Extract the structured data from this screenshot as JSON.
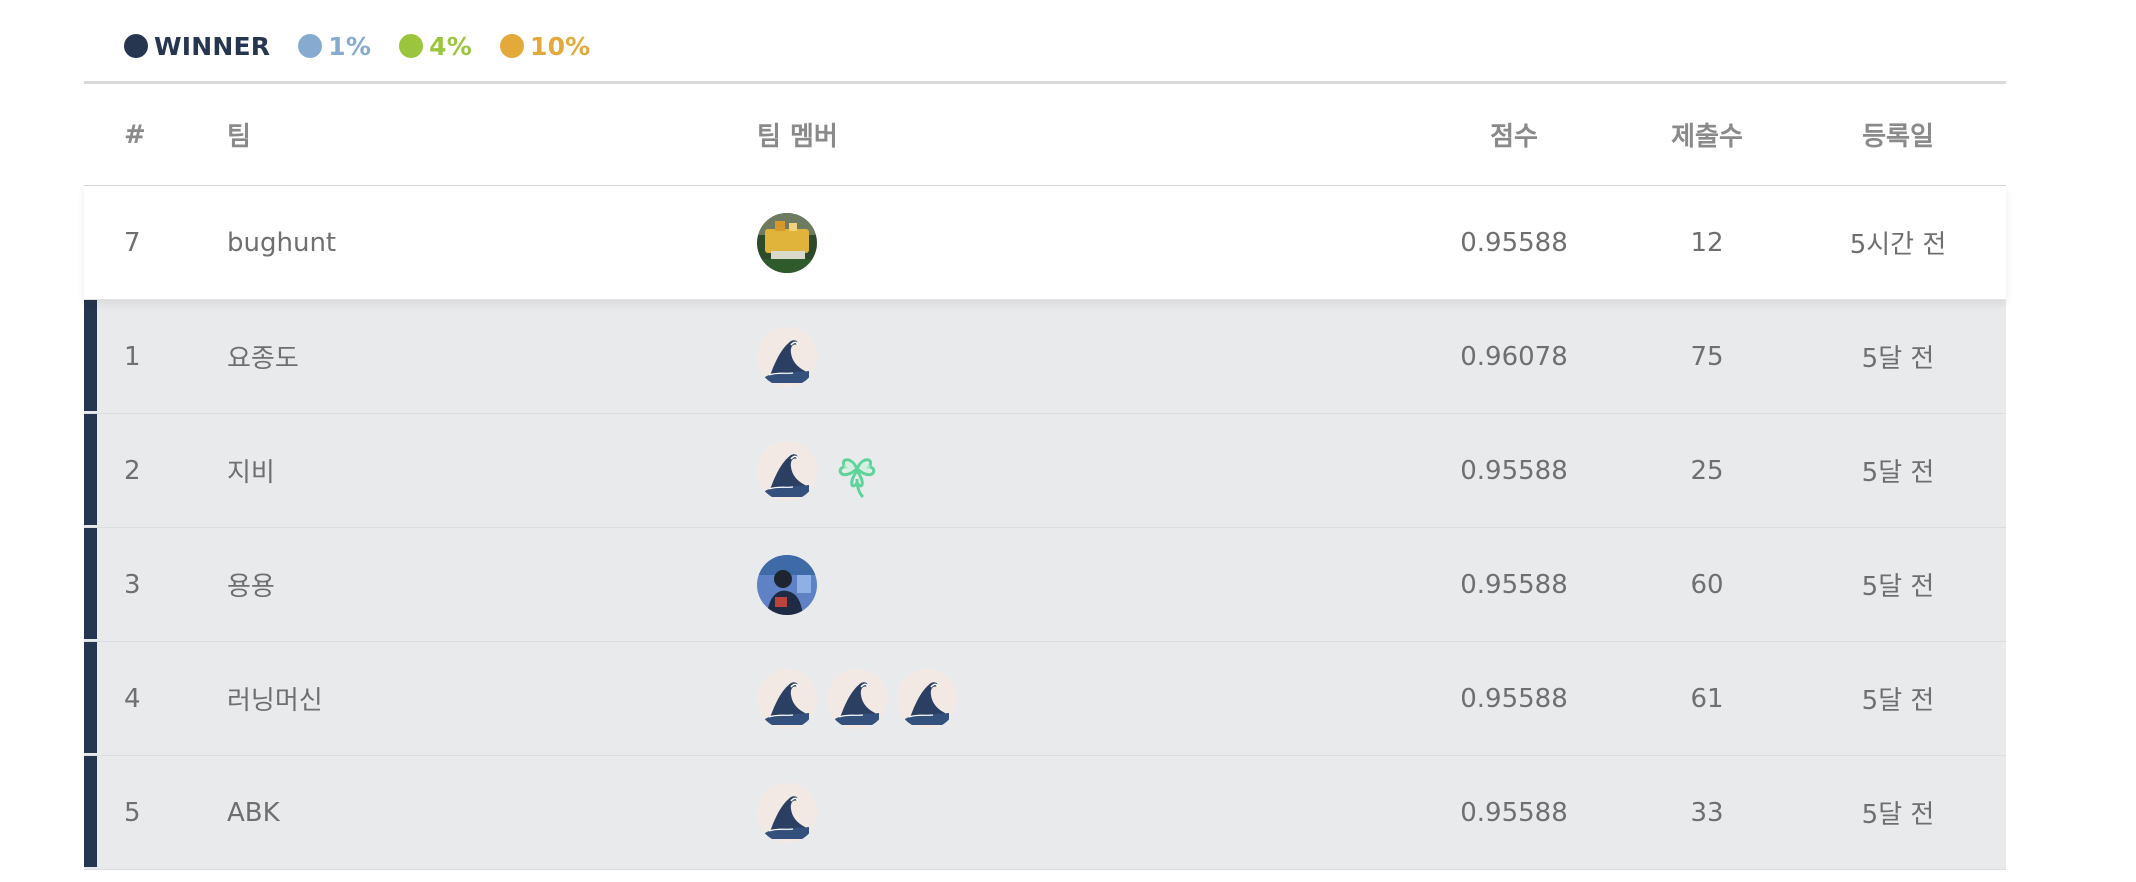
{
  "legend": [
    {
      "label": "WINNER",
      "color": "#263550"
    },
    {
      "label": "1%",
      "color": "#87abd0"
    },
    {
      "label": "4%",
      "color": "#9bc53d"
    },
    {
      "label": "10%",
      "color": "#e3a93b"
    }
  ],
  "columns": {
    "rank": "#",
    "team": "팀",
    "members": "팀 멤버",
    "score": "점수",
    "submissions": "제출수",
    "registered": "등록일"
  },
  "rows": [
    {
      "rank": "7",
      "team": "bughunt",
      "members": [
        "photo-trophy-avatar"
      ],
      "score": "0.95588",
      "submissions": "12",
      "registered": "5시간 전",
      "winner": false
    },
    {
      "rank": "1",
      "team": "요종도",
      "members": [
        "wave-avatar"
      ],
      "score": "0.96078",
      "submissions": "75",
      "registered": "5달 전",
      "winner": true
    },
    {
      "rank": "2",
      "team": "지비",
      "members": [
        "wave-avatar",
        "clover-avatar"
      ],
      "score": "0.95588",
      "submissions": "25",
      "registered": "5달 전",
      "winner": true
    },
    {
      "rank": "3",
      "team": "용용",
      "members": [
        "photo-person-avatar"
      ],
      "score": "0.95588",
      "submissions": "60",
      "registered": "5달 전",
      "winner": true
    },
    {
      "rank": "4",
      "team": "러닝머신",
      "members": [
        "wave-avatar",
        "wave-avatar",
        "wave-avatar"
      ],
      "score": "0.95588",
      "submissions": "61",
      "registered": "5달 전",
      "winner": true
    },
    {
      "rank": "5",
      "team": "ABK",
      "members": [
        "wave-avatar"
      ],
      "score": "0.95588",
      "submissions": "33",
      "registered": "5달 전",
      "winner": true
    }
  ]
}
